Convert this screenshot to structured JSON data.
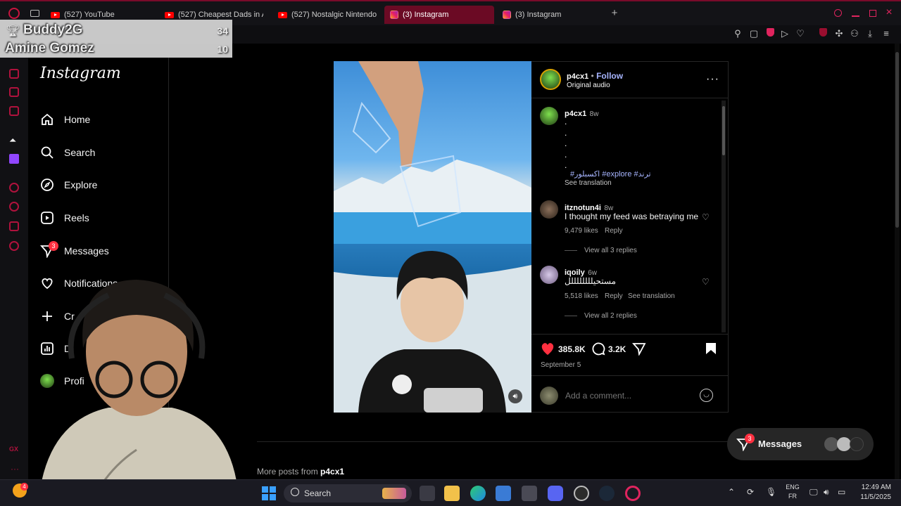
{
  "tabs": [
    {
      "label": "(527) YouTube",
      "icon": "youtube-icon"
    },
    {
      "label": "(527) Cheapest Dads in A",
      "icon": "youtube-icon"
    },
    {
      "label": "(527) Nostalgic Nintendo",
      "icon": "youtube-icon"
    },
    {
      "label": "(3) Instagram",
      "icon": "instagram-icon",
      "active": true
    },
    {
      "label": "(3) Instagram",
      "icon": "instagram-icon"
    }
  ],
  "overlay": {
    "rows": [
      {
        "name": "Buddy2G",
        "score": "34"
      },
      {
        "name": "Amine Gomez",
        "score": "10"
      }
    ]
  },
  "nav": {
    "logo": "Instagram",
    "items": [
      {
        "label": "Home",
        "icon": "home-icon"
      },
      {
        "label": "Search",
        "icon": "search-icon"
      },
      {
        "label": "Explore",
        "icon": "compass-icon"
      },
      {
        "label": "Reels",
        "icon": "reels-icon"
      },
      {
        "label": "Messages",
        "icon": "messenger-icon",
        "badge": "3"
      },
      {
        "label": "Notifications",
        "icon": "heart-icon"
      },
      {
        "label": "Cr",
        "icon": "plus-icon"
      },
      {
        "label": "D",
        "icon": "dashboard-icon"
      },
      {
        "label": "Profi",
        "icon": "avatar"
      }
    ]
  },
  "post": {
    "username": "p4cx1",
    "follow": "Follow",
    "audio": "Original audio",
    "caption": {
      "username": "p4cx1",
      "age": "8w",
      "dots": [
        ".",
        ".",
        ".",
        ".",
        "."
      ],
      "hashtags": "#اكسبلور #explore #ترند",
      "see_translation": "See translation"
    },
    "comments": [
      {
        "username": "itznotun4i",
        "age": "8w",
        "text": "I thought my feed was betraying me",
        "likes": "9,479 likes",
        "reply": "Reply",
        "view_replies": "View all 3 replies"
      },
      {
        "username": "iqoily",
        "age": "6w",
        "text": "مستحيللللللللل",
        "likes": "5,518 likes",
        "reply": "Reply",
        "see_translation": "See translation",
        "view_replies": "View all 2 replies"
      }
    ],
    "likes": "385.8K",
    "comments_count": "3.2K",
    "date": "September 5",
    "add_comment_placeholder": "Add a comment..."
  },
  "more_posts": {
    "prefix": "More posts from",
    "username": "p4cx1"
  },
  "messages_pill": {
    "label": "Messages",
    "badge": "3"
  },
  "taskbar": {
    "search": "Search",
    "lang": "ENG",
    "region": "FR",
    "time": "12:49 AM",
    "date": "11/5/2025",
    "notif_badge": "4"
  },
  "colors": {
    "accent": "#ff3040",
    "opera": "#b0123d",
    "link": "#a7b5ff"
  }
}
